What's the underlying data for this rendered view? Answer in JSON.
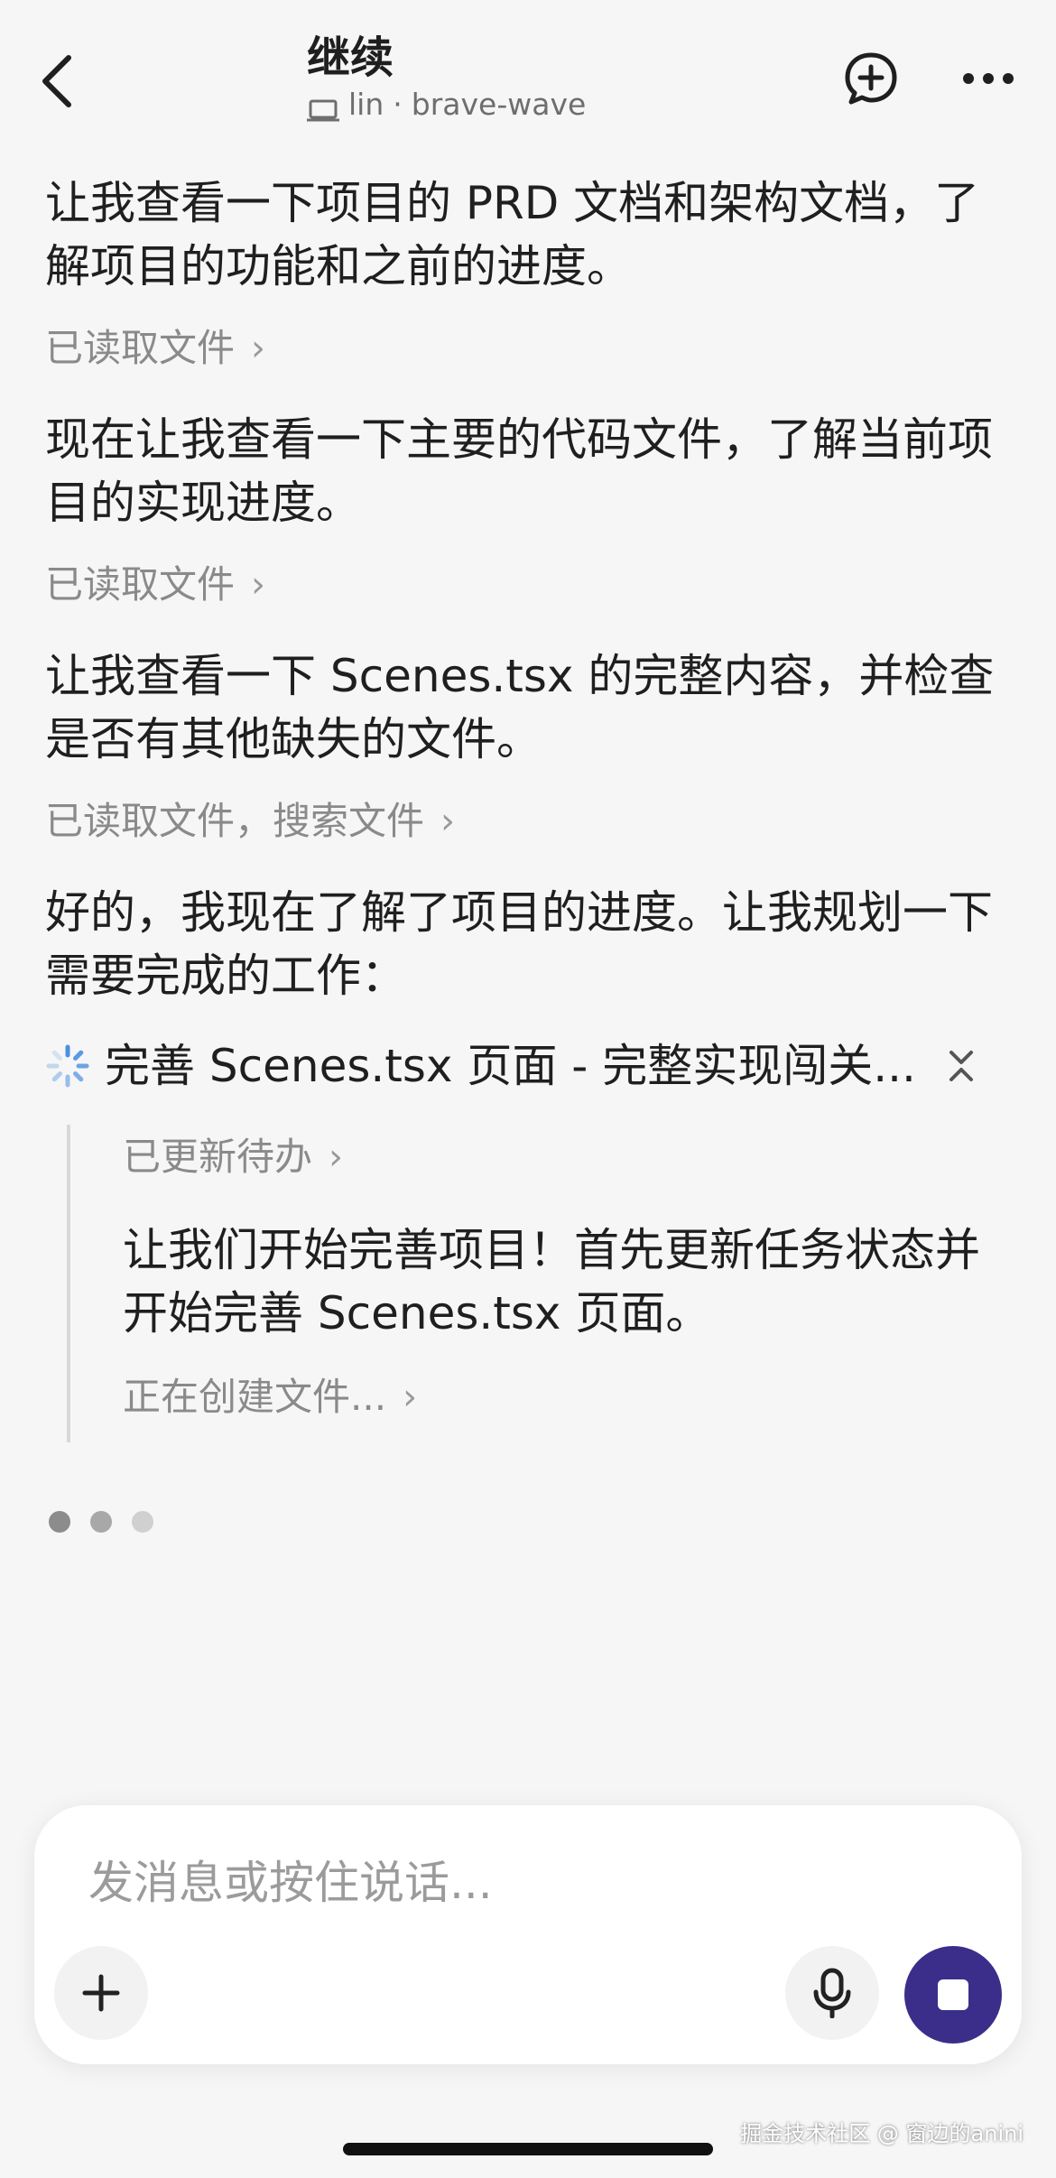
{
  "header": {
    "title": "继续",
    "device": "lin",
    "separator": "·",
    "project": "brave-wave",
    "icons": [
      "back-chevron-icon",
      "new-chat-plus-bubble-icon",
      "more-dots-icon"
    ]
  },
  "messages": [
    {
      "type": "text",
      "text": "让我查看一下项目的 PRD 文档和架构文档，了解项目的功能和之前的进度。"
    },
    {
      "type": "action",
      "label": "已读取文件"
    },
    {
      "type": "text",
      "text": "现在让我查看一下主要的代码文件，了解当前项目的实现进度。"
    },
    {
      "type": "action",
      "label": "已读取文件"
    },
    {
      "type": "text",
      "text": "让我查看一下 Scenes.tsx 的完整内容，并检查是否有其他缺失的文件。"
    },
    {
      "type": "action",
      "label": "已读取文件，搜索文件"
    },
    {
      "type": "text",
      "text": "好的，我现在了解了项目的进度。让我规划一下需要完成的工作："
    }
  ],
  "task": {
    "title": "完善 Scenes.tsx 页面 - 完整实现闯关...",
    "status": "in-progress",
    "children": [
      {
        "type": "action",
        "label": "已更新待办"
      },
      {
        "type": "text",
        "text": "让我们开始完善项目！首先更新任务状态并开始完善 Scenes.tsx 页面。"
      },
      {
        "type": "action",
        "label": "正在创建文件..."
      }
    ]
  },
  "loading_dots": 3,
  "composer": {
    "placeholder": "发消息或按住说话..."
  },
  "watermark": "掘金技术社区 @ 窗边的anini",
  "colors": {
    "background": "#f6f6f6",
    "text": "#1f1f1f",
    "muted": "#8a8a8a",
    "stop_button": "#3a2e8a",
    "spinner": "#4a90e2"
  }
}
